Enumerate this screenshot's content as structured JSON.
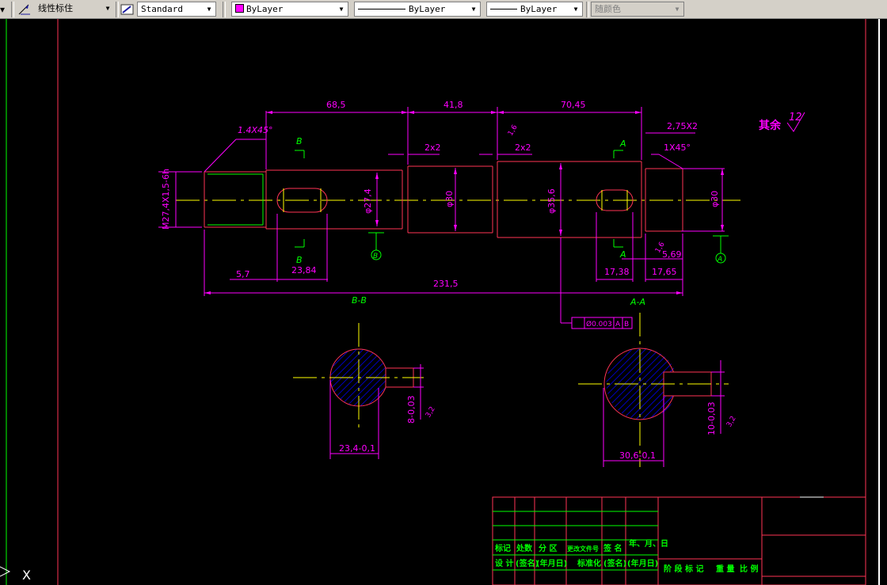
{
  "toolbar": {
    "dimstyle": {
      "icon": "dimension-style-icon",
      "value": "线性标住"
    },
    "textstyle": {
      "icon": "text-style-icon",
      "value": "Standard"
    },
    "layer_color": {
      "value": "ByLayer",
      "color": "#ff00ff"
    },
    "linetype": {
      "value": "ByLayer"
    },
    "lineweight": {
      "value": "ByLayer"
    },
    "plotstyle": {
      "value": "随颜色"
    }
  },
  "colors": {
    "magenta": "#ff00ff",
    "yellow": "#ffff00",
    "green": "#00ff00",
    "red": "#ff0000",
    "blue": "#0000ff",
    "background": "#000000"
  },
  "drawing": {
    "dims": {
      "d685": "68,5",
      "d418": "41,8",
      "d7045": "70,45",
      "d275": "2,75X2",
      "d14x45": "1.4X45°",
      "d1x45": "1X45°",
      "d2x2a": "2x2",
      "d2x2b": "2x2",
      "m27": "M27,4X1,5-6h",
      "phi274": "φ27,4",
      "phi30a": "φ30",
      "phi356": "φ35,6",
      "phi30b": "φ30",
      "d57": "5,7",
      "d2384": "23,84",
      "d2315": "231,5",
      "d1738": "17,38",
      "d1765": "17,65",
      "d569": "5,69",
      "r16a": "1,6",
      "r16b": "1,6",
      "r32a": "3,2",
      "r32b": "3,2",
      "sec_b_depth": "8-0,03",
      "sec_b_width": "23,4-0,1",
      "sec_a_depth": "10-0,03",
      "sec_a_width": "30,6-0,1",
      "tol_frame": "Ø0.003",
      "datum_a_ref": "A",
      "datum_b_ref": "B"
    },
    "labels": {
      "b_top": "B",
      "b_bot": "B",
      "a_top": "A",
      "a_bot": "A",
      "datum_b": "B",
      "datum_a": "A",
      "section_bb": "B-B",
      "section_aa": "A-A",
      "rest_rough": "其余",
      "rest_rough_val": "12"
    },
    "title_block": {
      "row1": [
        "标记",
        "处数",
        "分  区",
        "更改文件号",
        "签  名",
        "年、月、日"
      ],
      "row2": [
        "设  计",
        "(签名)",
        "(年月日)",
        "标准化",
        "(签名)",
        "(年月日)"
      ],
      "right": [
        "阶 段 标 记",
        "重 量",
        "比 例"
      ]
    },
    "ucs_label": "X"
  }
}
